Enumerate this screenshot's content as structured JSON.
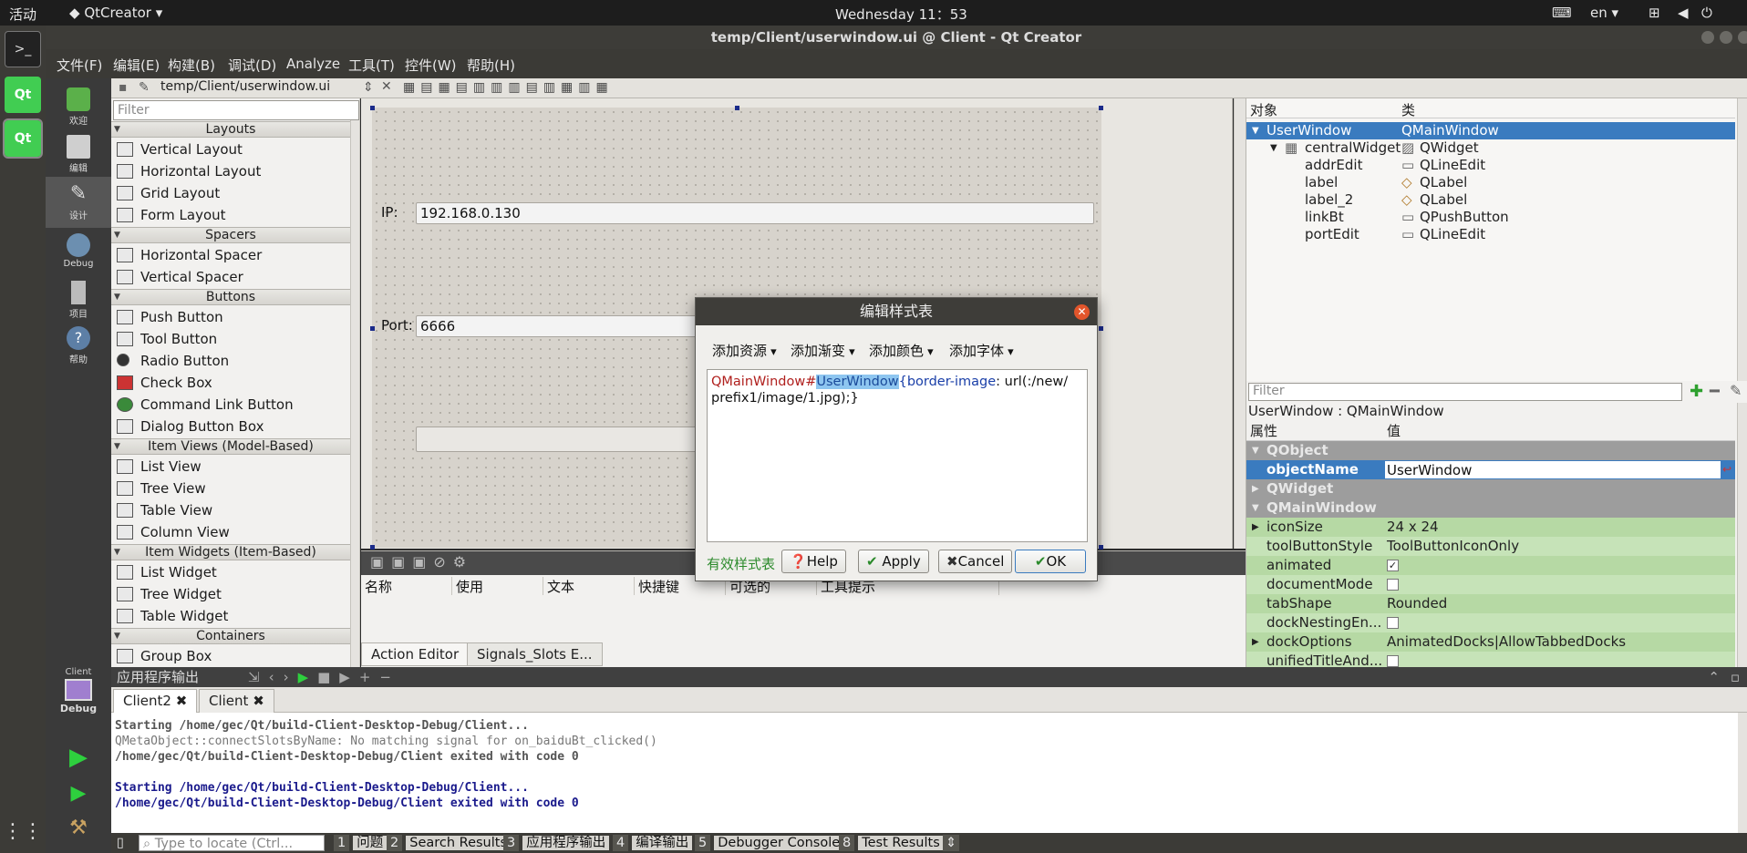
{
  "topbar": {
    "activities": "活动",
    "app_menu": "QtCreator",
    "clock": "Wednesday 11：53",
    "lang": "en"
  },
  "window": {
    "title": "temp/Client/userwindow.ui @ Client - Qt Creator"
  },
  "menubar": [
    "文件(F)",
    "编辑(E)",
    "构建(B)",
    "调试(D)",
    "Analyze",
    "工具(T)",
    "控件(W)",
    "帮助(H)"
  ],
  "modes": [
    {
      "label": "欢迎",
      "icon": "welcome-icon"
    },
    {
      "label": "编辑",
      "icon": "edit-icon"
    },
    {
      "label": "设计",
      "icon": "design-icon"
    },
    {
      "label": "Debug",
      "icon": "debug-icon"
    },
    {
      "label": "项目",
      "icon": "projects-icon"
    },
    {
      "label": "帮助",
      "icon": "help-icon"
    }
  ],
  "kit": {
    "project": "Client",
    "mode": "Debug"
  },
  "editor": {
    "file_path": "temp/Client/userwindow.ui"
  },
  "widgetbox": {
    "filter_placeholder": "Filter",
    "categories": {
      "layouts": "Layouts",
      "spacers": "Spacers",
      "buttons": "Buttons",
      "item_views": "Item Views (Model-Based)",
      "item_widgets": "Item Widgets (Item-Based)",
      "containers": "Containers"
    },
    "items": {
      "vertical_layout": "Vertical Layout",
      "horizontal_layout": "Horizontal Layout",
      "grid_layout": "Grid Layout",
      "form_layout": "Form Layout",
      "horizontal_spacer": "Horizontal Spacer",
      "vertical_spacer": "Vertical Spacer",
      "push_button": "Push Button",
      "tool_button": "Tool Button",
      "radio_button": "Radio Button",
      "check_box": "Check Box",
      "command_link_button": "Command Link Button",
      "dialog_button_box": "Dialog Button Box",
      "list_view": "List View",
      "tree_view": "Tree View",
      "table_view": "Table View",
      "column_view": "Column View",
      "list_widget": "List Widget",
      "tree_widget": "Tree Widget",
      "table_widget": "Table Widget",
      "group_box": "Group Box"
    }
  },
  "form": {
    "ip_label": "IP:",
    "ip_value": "192.168.0.130",
    "port_label": "Port:",
    "port_value": "6666"
  },
  "action_editor": {
    "columns": [
      "名称",
      "使用",
      "文本",
      "快捷键",
      "可选的",
      "工具提示"
    ],
    "tabs": [
      "Action Editor",
      "Signals_Slots E..."
    ]
  },
  "object_inspector": {
    "col_object": "对象",
    "col_class": "类",
    "rows": [
      {
        "name": "UserWindow",
        "cls": "QMainWindow"
      },
      {
        "name": "centralWidget",
        "cls": "QWidget"
      },
      {
        "name": "addrEdit",
        "cls": "QLineEdit"
      },
      {
        "name": "label",
        "cls": "QLabel"
      },
      {
        "name": "label_2",
        "cls": "QLabel"
      },
      {
        "name": "linkBt",
        "cls": "QPushButton"
      },
      {
        "name": "portEdit",
        "cls": "QLineEdit"
      }
    ]
  },
  "property_editor": {
    "filter_placeholder": "Filter",
    "caption": "UserWindow : QMainWindow",
    "col_prop": "属性",
    "col_value": "值",
    "groups": [
      "QObject",
      "QWidget",
      "QMainWindow"
    ],
    "props": {
      "objectName": {
        "name": "objectName",
        "value": "UserWindow"
      },
      "iconSize": {
        "name": "iconSize",
        "value": "24 x 24"
      },
      "toolButtonStyle": {
        "name": "toolButtonStyle",
        "value": "ToolButtonIconOnly"
      },
      "animated": {
        "name": "animated",
        "value": "✓"
      },
      "documentMode": {
        "name": "documentMode",
        "value": ""
      },
      "tabShape": {
        "name": "tabShape",
        "value": "Rounded"
      },
      "dockNesting": {
        "name": "dockNestingEn...",
        "value": ""
      },
      "dockOptions": {
        "name": "dockOptions",
        "value": "AnimatedDocks|AllowTabbedDocks"
      },
      "unifiedTitle": {
        "name": "unifiedTitleAnd...",
        "value": ""
      }
    }
  },
  "dialog": {
    "title": "编辑样式表",
    "menus": [
      "添加资源",
      "添加渐变",
      "添加颜色",
      "添加字体"
    ],
    "css_selector": "QMainWindow#",
    "css_id": "UserWindow",
    "css_prop": "{border-image",
    "css_value": ": url(:/new/",
    "css_line2": "prefix1/image/1.jpg);}",
    "valid_text": "有效样式表",
    "buttons": {
      "help": "Help",
      "apply": "Apply",
      "cancel": "Cancel",
      "ok": "OK"
    }
  },
  "output": {
    "title": "应用程序输出",
    "tabs": [
      "Client2",
      "Client"
    ],
    "lines": [
      {
        "text": "Starting /home/gec/Qt/build-Client-Desktop-Debug/Client...",
        "color": "#555555",
        "bold": true
      },
      {
        "text": "QMetaObject::connectSlotsByName: No matching signal for on_baiduBt_clicked()",
        "color": "#777777",
        "bold": false
      },
      {
        "text": "/home/gec/Qt/build-Client-Desktop-Debug/Client exited with code 0",
        "color": "#555555",
        "bold": true
      },
      {
        "text": "",
        "color": "#555555",
        "bold": false
      },
      {
        "text": "Starting /home/gec/Qt/build-Client-Desktop-Debug/Client...",
        "color": "#1a1a8c",
        "bold": true
      },
      {
        "text": "/home/gec/Qt/build-Client-Desktop-Debug/Client exited with code 0",
        "color": "#1a1a8c",
        "bold": true
      }
    ]
  },
  "statusbar": {
    "locate_placeholder": "Type to locate (Ctrl...",
    "panes": [
      {
        "num": "1",
        "label": "问题"
      },
      {
        "num": "2",
        "label": "Search Results"
      },
      {
        "num": "3",
        "label": "应用程序输出"
      },
      {
        "num": "4",
        "label": "编译输出"
      },
      {
        "num": "5",
        "label": "Debugger Console"
      },
      {
        "num": "8",
        "label": "Test Results"
      }
    ]
  },
  "colors": {
    "selection": "#3a7bbf",
    "green_row": "#b6d9a4",
    "group_row": "#9d9d9d",
    "close": "#e2552b"
  }
}
